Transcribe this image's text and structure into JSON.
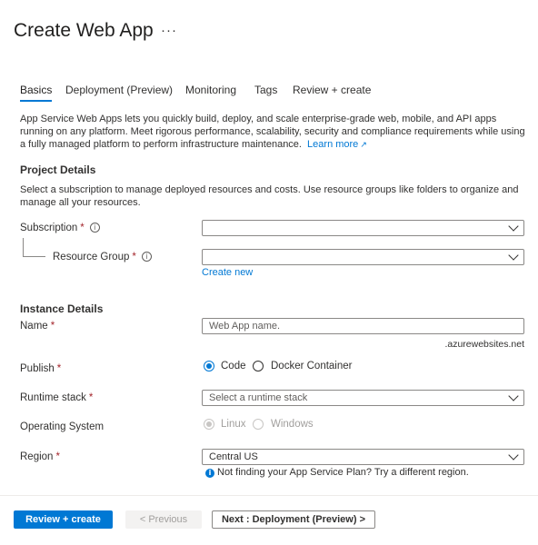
{
  "header": {
    "title": "Create Web App",
    "more": "···"
  },
  "tabs": [
    {
      "label": "Basics"
    },
    {
      "label": "Deployment (Preview)"
    },
    {
      "label": "Monitoring"
    },
    {
      "label": "Tags"
    },
    {
      "label": "Review + create"
    }
  ],
  "intro": {
    "text": "App Service Web Apps lets you quickly build, deploy, and scale enterprise-grade web, mobile, and API apps running on any platform. Meet rigorous performance, scalability, security and compliance requirements while using a fully managed platform to perform infrastructure maintenance.",
    "link": "Learn more"
  },
  "project": {
    "heading": "Project Details",
    "desc": "Select a subscription to manage deployed resources and costs. Use resource groups like folders to organize and manage all your resources.",
    "subscription_label": "Subscription",
    "subscription_value": "",
    "resource_group_label": "Resource Group",
    "resource_group_value": "",
    "create_new": "Create new"
  },
  "instance": {
    "heading": "Instance Details",
    "name_label": "Name",
    "name_placeholder": "Web App name.",
    "name_suffix": ".azurewebsites.net",
    "publish_label": "Publish",
    "publish_options": [
      "Code",
      "Docker Container"
    ],
    "publish_selected": "Code",
    "runtime_label": "Runtime stack",
    "runtime_placeholder": "Select a runtime stack",
    "os_label": "Operating System",
    "os_options": [
      "Linux",
      "Windows"
    ],
    "os_selected": "Linux",
    "region_label": "Region",
    "region_value": "Central US",
    "region_notice": "Not finding your App Service Plan? Try a different region."
  },
  "required_marker": "*",
  "footer": {
    "review_create": "Review + create",
    "previous": "< Previous",
    "next": "Next : Deployment (Preview) >"
  },
  "colors": {
    "accent": "#0078d4",
    "required": "#a4262c"
  }
}
